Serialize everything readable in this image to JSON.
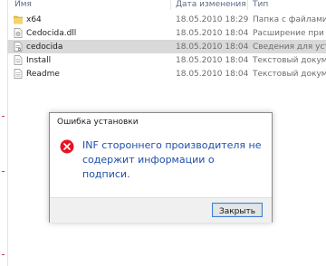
{
  "columns": {
    "name": "Имя",
    "date": "Дата изменения",
    "type": "Тип"
  },
  "files": [
    {
      "name": "x64",
      "date": "18.05.2010 18:29",
      "type": "Папка с файлами",
      "icon": "folder-icon"
    },
    {
      "name": "Cedocida.dll",
      "date": "18.05.2010 18:04",
      "type": "Расширение при",
      "icon": "dll-file-icon"
    },
    {
      "name": "cedocida",
      "date": "18.05.2010 18:04",
      "type": "Сведения для уст",
      "icon": "inf-file-icon",
      "selected": true
    },
    {
      "name": "Install",
      "date": "18.05.2010 18:04",
      "type": "Текстовый докум",
      "icon": "text-file-icon"
    },
    {
      "name": "Readme",
      "date": "18.05.2010 18:04",
      "type": "Текстовый докум",
      "icon": "text-file-icon"
    }
  ],
  "dialog": {
    "title": "Ошибка установки",
    "message": "INF стороннего производителя не содержит информации о подписи.",
    "close_button": "Закрыть",
    "icon": "error-icon"
  },
  "colors": {
    "selection": "#d9d9d9",
    "message_text": "#1f4fa8",
    "error_red": "#e81123",
    "folder_yellow": "#e9c04a"
  }
}
